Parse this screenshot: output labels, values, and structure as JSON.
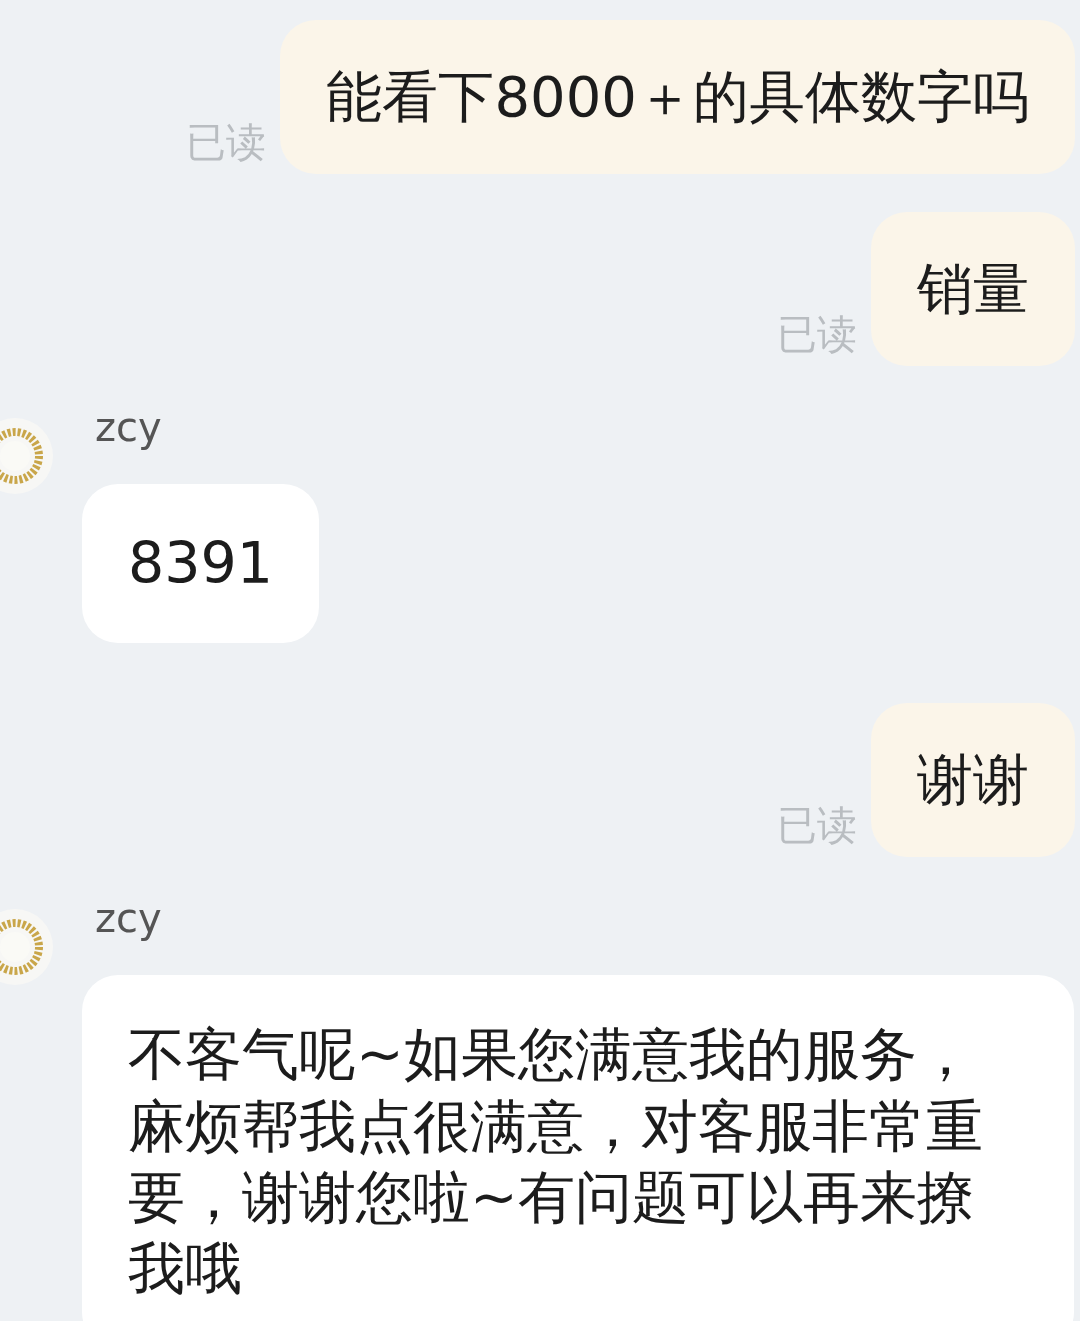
{
  "messages": [
    {
      "kind": "outgoing",
      "text": "能看下8000＋的具体数字吗",
      "status": "已读"
    },
    {
      "kind": "outgoing",
      "text": "销量",
      "status": "已读"
    },
    {
      "kind": "incoming",
      "sender": "zcy",
      "text": "8391"
    },
    {
      "kind": "outgoing",
      "text": "谢谢",
      "status": "已读"
    },
    {
      "kind": "incoming",
      "sender": "zcy",
      "text": "不客气呢~如果您满意我的服务，麻烦帮我点很满意，对客服非常重要，谢谢您啦~有问题可以再来撩我哦"
    }
  ]
}
